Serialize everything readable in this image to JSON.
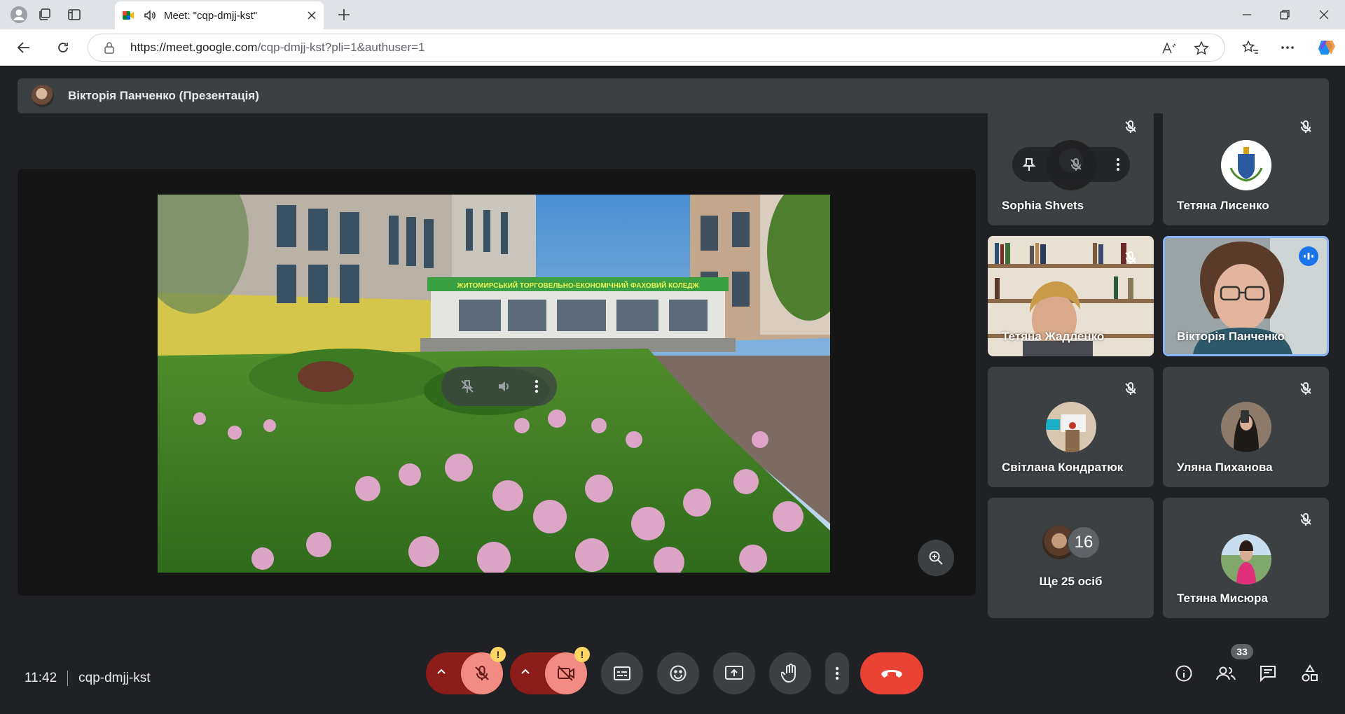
{
  "browser": {
    "tab_title": "Meet: \"cqp-dmjj-kst\"",
    "url_host": "https://meet.google.com",
    "url_path": "/cqp-dmjj-kst?pli=1&authuser=1"
  },
  "presentation": {
    "presenter_label": "Вікторія Панченко (Презентація)",
    "slide_sign_text": "ЖИТОМИРСЬКИЙ ТОРГОВЕЛЬНО-ЕКОНОМІЧНИЙ ФАХОВИЙ КОЛЕДЖ"
  },
  "participants": [
    {
      "name": "Sophia Shvets",
      "muted": true
    },
    {
      "name": "Тетяна Лисенко",
      "muted": true
    },
    {
      "name": "Тетяна Жадленко",
      "muted": true
    },
    {
      "name": "Вікторія Панченко",
      "muted": false,
      "speaking": true
    },
    {
      "name": "Світлана Кондратюк",
      "muted": true
    },
    {
      "name": "Уляна Пиханова",
      "muted": true
    },
    {
      "name": "Ще 25 осіб",
      "count_badge": "16"
    },
    {
      "name": "Тетяна Мисюра",
      "muted": true
    }
  ],
  "footer": {
    "time": "11:42",
    "meeting_code": "cqp-dmjj-kst",
    "warning_mark": "!",
    "people_count": "33"
  },
  "colors": {
    "background": "#202124",
    "tile": "#3c4043",
    "end_call": "#ea4335",
    "active_border": "#8ab4f8",
    "warning": "#fdd663"
  },
  "icons": [
    "profile-icon",
    "workspaces-icon",
    "tab-actions-icon",
    "meet-logo-icon",
    "speaker-icon",
    "close-icon",
    "plus-icon",
    "minimize-icon",
    "restore-icon",
    "back-icon",
    "refresh-icon",
    "lock-icon",
    "read-aloud-icon",
    "star-icon",
    "favorites-icon",
    "more-icon",
    "copilot-icon",
    "pin-icon",
    "mic-off-icon",
    "volume-icon",
    "zoom-icon",
    "camera-off-icon",
    "captions-icon",
    "emoji-icon",
    "present-icon",
    "raise-hand-icon",
    "end-call-icon",
    "info-icon",
    "people-icon",
    "chat-icon",
    "activities-icon"
  ]
}
